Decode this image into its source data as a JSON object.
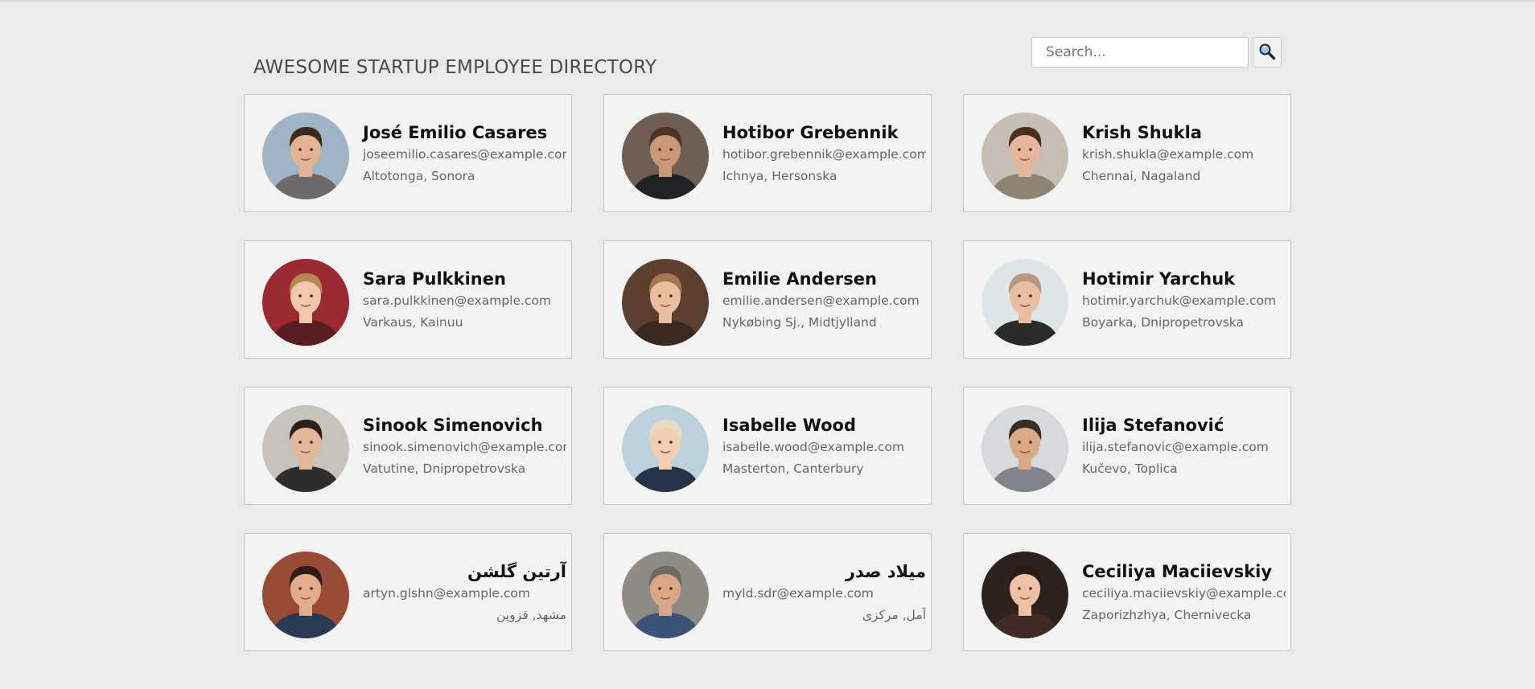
{
  "header": {
    "title": "AWESOME STARTUP EMPLOYEE DIRECTORY"
  },
  "search": {
    "placeholder": "Search...",
    "value": "",
    "button_icon": "magnifier-icon"
  },
  "employees": [
    {
      "name": "José Emilio Casares",
      "email": "joseemilio.casares@example.com",
      "location": "Altotonga, Sonora",
      "avatar": {
        "bg": "#9fb3c4",
        "skin": "#e2b394",
        "hair": "#3b2a1e",
        "shirt": "#6e6a6a"
      }
    },
    {
      "name": "Hotibor Grebennik",
      "email": "hotibor.grebennik@example.com",
      "location": "Ichnya, Hersonska",
      "avatar": {
        "bg": "#6e5f52",
        "skin": "#c99878",
        "hair": "#4a3526",
        "shirt": "#1f2226"
      }
    },
    {
      "name": "Krish Shukla",
      "email": "krish.shukla@example.com",
      "location": "Chennai, Nagaland",
      "avatar": {
        "bg": "#c6beb2",
        "skin": "#e5b69a",
        "hair": "#4a2e1f",
        "shirt": "#8f8474"
      }
    },
    {
      "name": "Sara Pulkkinen",
      "email": "sara.pulkkinen@example.com",
      "location": "Varkaus, Kainuu",
      "avatar": {
        "bg": "#9c2a32",
        "skin": "#f0c8aa",
        "hair": "#b58a52",
        "shirt": "#5a1e22"
      }
    },
    {
      "name": "Emilie Andersen",
      "email": "emilie.andersen@example.com",
      "location": "Nykøbing Sj., Midtjylland",
      "avatar": {
        "bg": "#5c3f2e",
        "skin": "#e9bf9f",
        "hair": "#a5774e",
        "shirt": "#3b2a20"
      }
    },
    {
      "name": "Hotimir Yarchuk",
      "email": "hotimir.yarchuk@example.com",
      "location": "Boyarka, Dnipropetrovska",
      "avatar": {
        "bg": "#dfe6ea",
        "skin": "#e9bfa2",
        "hair": "#b9977c",
        "shirt": "#2a2a2a"
      }
    },
    {
      "name": "Sinook Simenovich",
      "email": "sinook.simenovich@example.com",
      "location": "Vatutine, Dnipropetrovska",
      "avatar": {
        "bg": "#c7c3bc",
        "skin": "#e3b899",
        "hair": "#2b2019",
        "shirt": "#2e2d2c"
      }
    },
    {
      "name": "Isabelle Wood",
      "email": "isabelle.wood@example.com",
      "location": "Masterton, Canterbury",
      "avatar": {
        "bg": "#bcd1dc",
        "skin": "#f1cdb1",
        "hair": "#e8dac0",
        "shirt": "#263448"
      }
    },
    {
      "name": "Ilija Stefanović",
      "email": "ilija.stefanovic@example.com",
      "location": "Kučevo, Toplica",
      "avatar": {
        "bg": "#d6dadd",
        "skin": "#d9a988",
        "hair": "#3a2c22",
        "shirt": "#7f858a"
      }
    },
    {
      "name": "آرتین گلشن",
      "email": "artyn.glshn@example.com",
      "location": "مشهد, قزوین",
      "avatar": {
        "bg": "#9a4b36",
        "skin": "#e3ac8c",
        "hair": "#2b1d16",
        "shirt": "#2a3a50"
      }
    },
    {
      "name": "میلاد صدر",
      "email": "myld.sdr@example.com",
      "location": "آمل, مرکزی",
      "avatar": {
        "bg": "#8f8c85",
        "skin": "#d9a786",
        "hair": "#6d6a64",
        "shirt": "#3e5476"
      }
    },
    {
      "name": "Ceciliya Maciievskiy",
      "email": "ceciliya.maciievskiy@example.com",
      "location": "Zaporizhzhya, Chernivecka",
      "avatar": {
        "bg": "#2e221d",
        "skin": "#ecc1a4",
        "hair": "#2a1a14",
        "shirt": "#402b24"
      }
    }
  ]
}
